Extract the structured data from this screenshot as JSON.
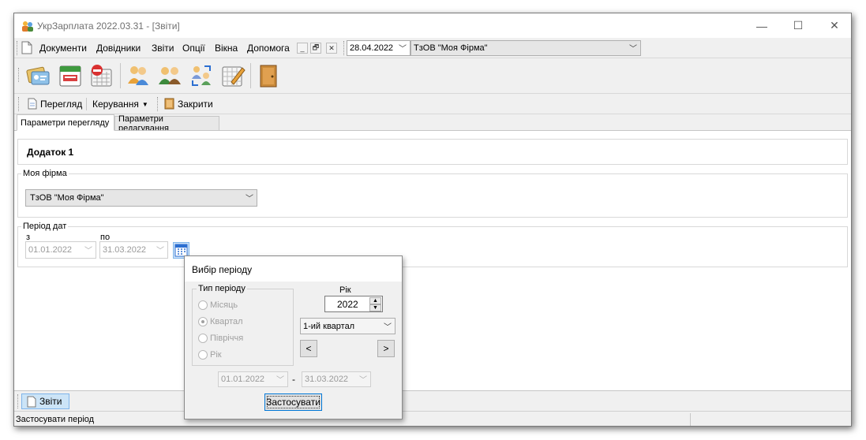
{
  "window": {
    "title": "УкрЗарплата 2022.03.31 - [Звіти]",
    "minimize": "—",
    "maximize": "☐",
    "close": "✕"
  },
  "menu": {
    "items": [
      "Документи",
      "Довідники",
      "Звіти",
      "Опції",
      "Вікна",
      "Допомога"
    ],
    "mdi_minimize": "_",
    "mdi_restore": "🗗",
    "mdi_close": "✕",
    "date": "28.04.2022",
    "company": "ТзОВ \"Моя Фірма\""
  },
  "toolbar": {
    "icons": [
      "cards-icon",
      "calendar-icon",
      "stop-calendar-icon",
      "people-icon",
      "users-icon",
      "transfer-icon",
      "planner-icon",
      "exit-door-icon"
    ]
  },
  "subtoolbar": {
    "view": "Перегляд",
    "manage": "Керування",
    "close": "Закрити"
  },
  "tabs": {
    "view_params": "Параметри перегляду",
    "edit_params": "Параметри редагування"
  },
  "report": {
    "title": "Додаток 1",
    "firm_legend": "Моя фірма",
    "firm_value": "ТзОВ \"Моя Фірма\"",
    "period_legend": "Період дат",
    "from_label": "з",
    "to_label": "по",
    "from_date": "01.01.2022",
    "to_date": "31.03.2022"
  },
  "dialog": {
    "title": "Вибір періоду",
    "type_legend": "Тип періоду",
    "options": [
      "Місяць",
      "Квартал",
      "Півріччя",
      "Рік"
    ],
    "selected_option": "Квартал",
    "year_label": "Рік",
    "year": "2022",
    "quarter": "1-ий квартал",
    "prev": "<",
    "next": ">",
    "from_date": "01.01.2022",
    "dash": "-",
    "to_date": "31.03.2022",
    "apply": "Застосувати"
  },
  "bottom_tab": "Звіти",
  "status": "Застосувати період",
  "colors": {
    "calendar_blue": "#2c6fd1",
    "selection_border": "#7eb4ea",
    "toolbar_orange": "#e8a23a"
  }
}
